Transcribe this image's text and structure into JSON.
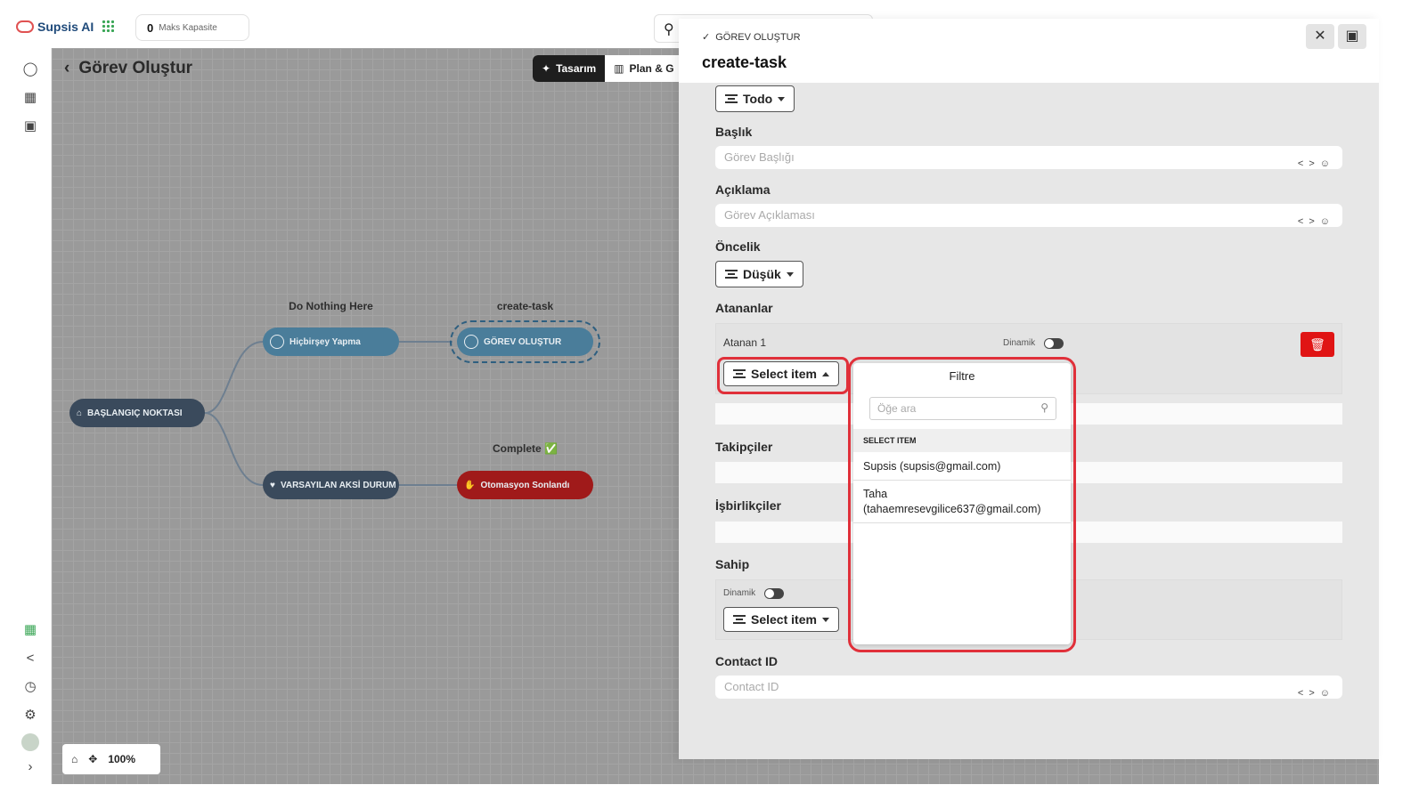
{
  "topbar": {
    "brand": "Supsis AI",
    "capacity_value": "0",
    "capacity_label": "Maks Kapasite"
  },
  "canvas": {
    "title": "Görev Oluştur",
    "tabs": [
      "Tasarım",
      "Plan & G"
    ],
    "zoom": "100%",
    "nodes": {
      "start": "BAŞLANGIÇ NOKTASI",
      "nothing": "Hiçbirşey Yapma",
      "nothing_caption": "Do Nothing Here",
      "create": "GÖREV OLUŞTUR",
      "create_caption": "create-task",
      "default": "VARSAYILAN AKSİ DURUM",
      "ended": "Otomasyon Sonlandı",
      "ended_caption": "Complete ✅"
    }
  },
  "panel": {
    "subtitle": "GÖREV OLUŞTUR",
    "title": "create-task",
    "status_value": "Todo",
    "fields": {
      "title_label": "Başlık",
      "title_placeholder": "Görev Başlığı",
      "desc_label": "Açıklama",
      "desc_placeholder": "Görev Açıklaması",
      "priority_label": "Öncelik",
      "priority_value": "Düşük",
      "assignees_label": "Atananlar",
      "assignee_1": "Atanan 1",
      "dynamic": "Dinamik",
      "select_item": "Select item",
      "followers_label": "Takipçiler",
      "collaborators_label": "İşbirlikçiler",
      "owner_label": "Sahip",
      "contact_label": "Contact ID",
      "contact_placeholder": "Contact ID"
    }
  },
  "popup": {
    "title": "Filtre",
    "search_placeholder": "Öğe ara",
    "section": "SELECT ITEM",
    "items": [
      {
        "line1": "Supsis (supsis@gmail.com)"
      },
      {
        "line1": "Taha",
        "line2": "(tahaemresevgilice637@gmail.com)"
      }
    ]
  },
  "colors": {
    "accent_red": "#e0303a",
    "node_blue": "#4a7d9a",
    "node_dark": "#3a4a5c",
    "node_red": "#a01a1a",
    "trash_red": "#e01414"
  }
}
